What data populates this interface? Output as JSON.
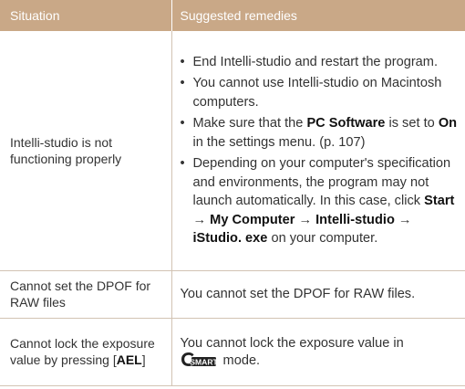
{
  "table": {
    "header": {
      "situation": "Situation",
      "remedies": "Suggested remedies"
    },
    "rows": [
      {
        "situation": "Intelli-studio is not functioning properly",
        "remedies": [
          "End Intelli-studio and restart the program.",
          "You cannot use Intelli-studio on Macintosh computers.",
          {
            "t1": "Make sure that the ",
            "b1": "PC Software",
            "t2": " is set to ",
            "b2": "On",
            "t3": " in the settings menu. (p. 107)"
          },
          {
            "t1": "Depending on your computer's specification and environments, the program may not launch automatically. In this case, click ",
            "b1": "Start",
            "arrow1": " → ",
            "b2": "My Computer",
            "arrow2": " → ",
            "b3": "Intelli-studio",
            "arrow3": " → ",
            "b4": "iStudio. exe",
            "t2": " on your computer."
          }
        ]
      },
      {
        "situation": "Cannot set the DPOF for RAW files",
        "remedy": "You cannot set the DPOF for RAW files."
      },
      {
        "situation_text": "Cannot lock the exposure value by pressing ",
        "situation_key_open": "[",
        "situation_key": "AEL",
        "situation_key_close": "]",
        "remedy_text": "You cannot lock the exposure value in ",
        "remedy_icon": "smart-mode-icon",
        "remedy_icon_label": "SMART",
        "remedy_suffix": " mode."
      }
    ]
  },
  "colors": {
    "header_bg": "#c9a887",
    "header_text": "#ffffff",
    "body_text": "#333333",
    "rule": "#d2c3b3"
  }
}
